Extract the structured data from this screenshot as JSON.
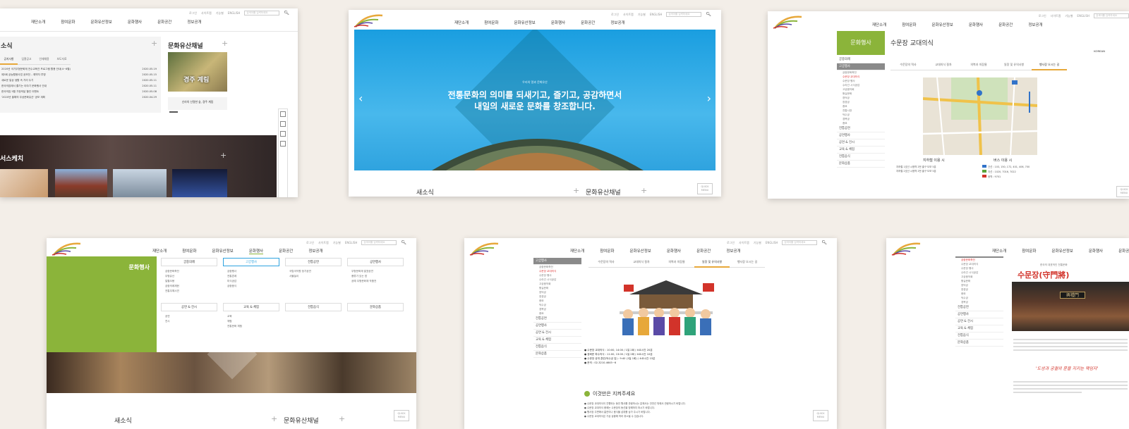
{
  "colors": {
    "background": "#f3eee8",
    "accent_green": "#8bb43a",
    "sky_blue": "#2ea8e6",
    "accent_red": "#d2332a"
  },
  "header": {
    "gnb": [
      "재단소개",
      "참여문화",
      "문화유산정보",
      "문화행사",
      "문화공간",
      "정보공개"
    ],
    "util": [
      "로그인",
      "사이트맵",
      "기능별",
      "ENGLISH"
    ],
    "search_placeholder": "검색어를 입력하세요"
  },
  "card1": {
    "news_title": "새소식",
    "news_title_visible": "소식",
    "news_tabs": [
      "공지사항",
      "입찰공고",
      "인재채용",
      "보도자료"
    ],
    "news_items": [
      {
        "text": "2020년 국가무형문화재 전수교육관 프로그램 활용 안내(4~6월)",
        "date": "2020.05.19"
      },
      {
        "text": "제3회 궁능활용사업 공모전 – 예약자 투명",
        "date": "2020.05.15"
      },
      {
        "text": "새로운 일상 생활 속 거리 두기",
        "date": "2020.05.11"
      },
      {
        "text": "한국의집에서 즐기는 이야기 문화행사 안내",
        "date": "2020.05.11"
      },
      {
        "text": "한국의집 5월 가정의달 할인 이벤트",
        "date": "2020.05.08"
      },
      {
        "text": "'2020년 올해의 무상문화유산' 공모 계획",
        "date": "2020.04.29"
      }
    ],
    "channel_title": "문화유산채널",
    "channel_banner": "경주 계림",
    "channel_caption": "신라의 신령한 숲, 경주 계림",
    "sketch_title": "문화유산스케치",
    "sketch_title_visible": "서스케치"
  },
  "card2": {
    "hero_small": "우리의 얼과 문화유산",
    "hero_line1": "전통문화의 의미를 되새기고, 즐기고, 공감하면서",
    "hero_line2": "내일의 새로운 문화를 창조합니다.",
    "news_title": "새소식",
    "channel_title": "문화유산채널",
    "quick": "QUICK MENU"
  },
  "card3": {
    "side_title": "문화행사",
    "page_title": "수문장 교대의식",
    "lnb": [
      "궁중의례",
      "고궁행사",
      "전통공연",
      "공연행사",
      "공연 & 전시",
      "교육 & 체험",
      "전통음식",
      "문화상품"
    ],
    "lnb_sub": [
      "궁중문화축전",
      "수문장 교대의식",
      "수문장 행사",
      "수라간 시식공감",
      "고궁음악회",
      "왕실문화",
      "창덕궁",
      "창경궁",
      "종묘",
      "전통시장",
      "덕수궁",
      "경복궁",
      "종묘"
    ],
    "tabs": [
      "수문장의 역사",
      "교대의식 절차",
      "의복과 의장물",
      "일정 및 유의사항",
      "행사장 오시는 길"
    ],
    "map_caption_left": "지하철 이용 시",
    "map_caption_right": "버스 이용 시",
    "subway_lines": [
      "지하철 1호선 시청역 2번 출구 도보 5분",
      "지하철 2호선 시청역 2번 출구 도보 5분"
    ],
    "bus_lines": [
      "간선 : 103, 150, 172, 401, 406, 700",
      "지선 : 1020, 7016, 7022",
      "광역 : 9701"
    ],
    "lang": "KOREAN",
    "quick": "QUICK MENU"
  },
  "card4": {
    "side_title": "문화행사",
    "columns": [
      {
        "head": "궁중의례",
        "items": [
          "궁중문화축전",
          "무형유산",
          "일월오봉",
          "궁중의례재현",
          "전통무예시연"
        ]
      },
      {
        "head": "고궁행사",
        "items": [
          "궁중행사",
          "전통혼례",
          "미식공감",
          "궁중음식"
        ]
      },
      {
        "head": "전통공연",
        "items": [
          "국립국악원 정기공연",
          "사물놀이"
        ]
      },
      {
        "head": "공연행사",
        "items": [
          "무형문화재 발표공연",
          "풍류가 있는 밤",
          "공예 무형문화재 작품전"
        ]
      }
    ],
    "columns2": [
      {
        "head": "공연 & 전시",
        "items": [
          "공연",
          "전시"
        ]
      },
      {
        "head": "교육 & 체험",
        "items": [
          "교육",
          "체험",
          "전통문화 체험"
        ]
      },
      {
        "head": "전통음식",
        "items": []
      },
      {
        "head": "문화상품",
        "items": []
      }
    ],
    "news_title": "새소식",
    "channel_title": "문화유산채널",
    "quick": "QUICK MENU"
  },
  "card5": {
    "lnb": [
      "고궁행사",
      "전통공연",
      "공연행사",
      "공연 & 전시",
      "교육 & 체험",
      "전통음식",
      "문화상품"
    ],
    "lnb_sub": [
      "궁중문화축전",
      "수문장 교대의식",
      "수문장 행사",
      "수라간 시식공감",
      "고궁음악회",
      "왕실문화",
      "창덕궁",
      "창경궁",
      "종묘",
      "덕수궁",
      "경복궁",
      "종묘"
    ],
    "tabs": [
      "수문장의 역사",
      "교대의식 절차",
      "의복과 의장물",
      "일정 및 유의사항",
      "행사장 오시는 길"
    ],
    "info": [
      "수문장 교대의식 : 10:00, 14:00 / 1일 2회 / 소요시간 20분",
      "광화문 파수의식 : 11:00, 13:00 / 1일 2회 / 소요시간 10분",
      "수문장 공개 훈련(덕수궁 앞) : 9:40 (1일 1회) / 소요시간 15분",
      "문의 : 02-3210-4645~6"
    ],
    "notice_title": "이것만은 지켜주세요",
    "notices": [
      "수문장 교대의식이 진행되는 동안 행사를 관람하시는 분께서는 안전선 밖에서 관람하시기 바랍니다.",
      "수문장 교대의식 중에는 수문장의 동선을 방해하지 마시기 바랍니다.",
      "행사장 주변에서 흡연이나 음식물 섭취를 삼가 주시기 바랍니다.",
      "수문장 교대의식은 기상 상황에 따라 취소될 수 있습니다."
    ],
    "quick": "QUICK MENU"
  },
  "card6": {
    "gnb": [
      "재단소개",
      "참여문화",
      "문화유산정보",
      "문화행사",
      "문화공간"
    ],
    "subtitle": "한국의 대표적인 전통문화",
    "title": "수문장(守門將)",
    "banner_sign": "興禮門",
    "quote": "'도성과 궁궐의 문을 지키는 책임자'",
    "lnb_sub": [
      "궁중문화축전",
      "수문장 교대의식",
      "수문장 행사",
      "수라간 시식공감",
      "고궁음악회",
      "왕실문화",
      "창덕궁",
      "창경궁",
      "종묘",
      "덕수궁",
      "경복궁"
    ],
    "lnb": [
      "전통공연",
      "공연행사",
      "공연 & 전시",
      "교육 & 체험",
      "전통음식",
      "문화상품"
    ]
  }
}
